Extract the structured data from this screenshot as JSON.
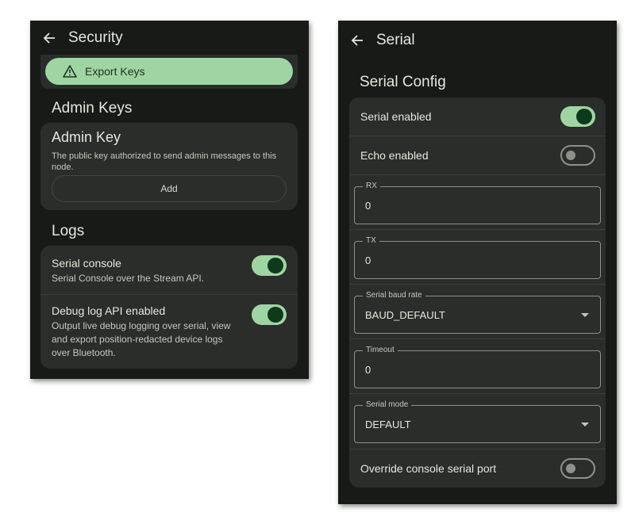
{
  "left": {
    "title": "Security",
    "export_keys_label": "Export Keys",
    "admin_keys_heading": "Admin Keys",
    "admin_key": {
      "title": "Admin Key",
      "description": "The public key authorized to send admin messages to this node.",
      "add_label": "Add"
    },
    "logs_heading": "Logs",
    "logs": [
      {
        "title": "Serial console",
        "subtitle": "Serial Console over the Stream API.",
        "enabled": true
      },
      {
        "title": "Debug log API enabled",
        "subtitle": "Output live debug logging over serial, view and export position-redacted device logs over Bluetooth.",
        "enabled": true
      }
    ]
  },
  "right": {
    "title": "Serial",
    "section_heading": "Serial Config",
    "serial_enabled": {
      "label": "Serial enabled",
      "enabled": true
    },
    "echo_enabled": {
      "label": "Echo enabled",
      "enabled": false
    },
    "rx": {
      "label": "RX",
      "value": "0"
    },
    "tx": {
      "label": "TX",
      "value": "0"
    },
    "baud": {
      "label": "Serial baud rate",
      "value": "BAUD_DEFAULT"
    },
    "timeout": {
      "label": "Timeout",
      "value": "0"
    },
    "mode": {
      "label": "Serial mode",
      "value": "DEFAULT"
    },
    "override": {
      "label": "Override console serial port",
      "enabled": false
    }
  },
  "colors": {
    "background": "#181a17",
    "card": "#2b2d2a",
    "accent": "#9fd5a2",
    "toggle_knob_on": "#0e3a1c"
  },
  "icons": {
    "back": "arrow-back-icon",
    "warning": "warning-icon",
    "dropdown": "chevron-down-icon"
  }
}
